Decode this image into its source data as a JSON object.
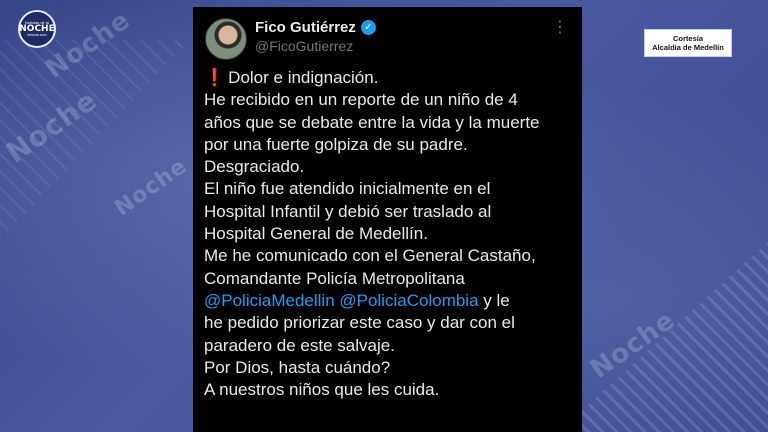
{
  "watermark": {
    "brand": "Noche",
    "small": "Noticias de la Noche Infonoe.com"
  },
  "logo": {
    "top": "Noticias de la",
    "main": "NOCHE",
    "bottom": "infonoe.com"
  },
  "credit": {
    "line1": "Cortesía",
    "line2": "Alcaldía de Medellín"
  },
  "tweet": {
    "author_name": "Fico Gutiérrez",
    "handle": "@FicoGutierrez",
    "more_icon": "⋮",
    "verified_icon": "✓",
    "exclamation_icon": "❗",
    "lines": {
      "l1": "Dolor e indignación.",
      "l2": "He recibido en un reporte de un niño de 4",
      "l3": "años que se debate entre la vida y la muerte",
      "l4": "por una fuerte golpiza de su padre.",
      "l5": "Desgraciado.",
      "l6": "El niño fue atendido inicialmente en el",
      "l7": "Hospital Infantil y debió ser traslado al",
      "l8": "Hospital General de Medellín.",
      "l9": "Me he comunicado con el General Castaño,",
      "l10": "Comandante Policía Metropolitana",
      "mention1": "@PoliciaMedellin",
      "mention2": "@PoliciaColombia",
      "l11_tail": " y le",
      "l12": "he pedido priorizar este caso y dar con el",
      "l13": "paradero de este salvaje.",
      "l14": "Por Dios, hasta cuándo?",
      "l15": "A nuestros niños que les cuida."
    }
  },
  "colors": {
    "background": "#3f4f93",
    "tweet_bg": "#000000",
    "text": "#e7e9ea",
    "muted": "#71767b",
    "link": "#1d9bf0",
    "verified": "#1d9bf0",
    "alert": "#f4212e"
  }
}
